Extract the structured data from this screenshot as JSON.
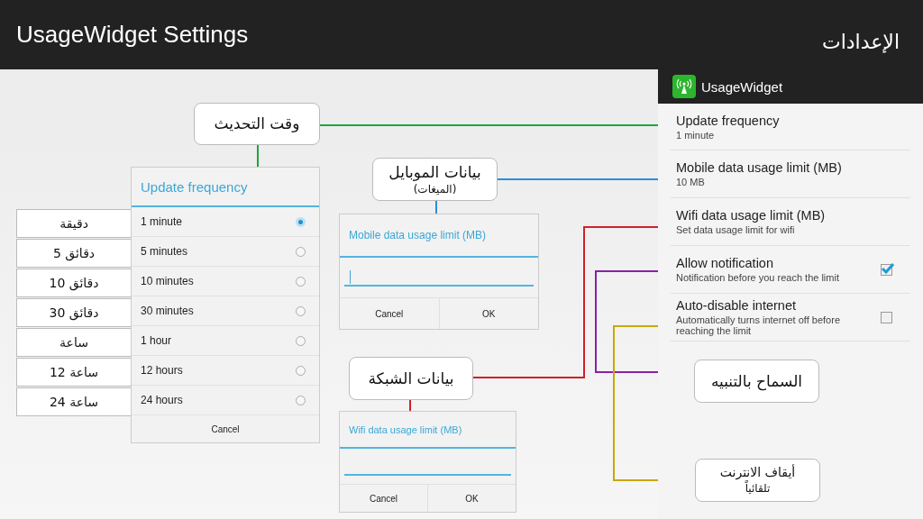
{
  "header": {
    "title": "UsageWidget Settings",
    "subtitle": "الإعدادات"
  },
  "app": {
    "title": "UsageWidget",
    "settings": [
      {
        "kind": "text",
        "title": "Update frequency",
        "summary": "1 minute"
      },
      {
        "kind": "text",
        "title": "Mobile data usage limit (MB)",
        "summary": "10 MB"
      },
      {
        "kind": "text",
        "title": "Wifi data usage limit (MB)",
        "summary": "Set data usage limit for wifi"
      },
      {
        "kind": "checkbox",
        "title": "Allow notification",
        "summary": "Notification before you reach the limit",
        "checked": true
      },
      {
        "kind": "checkbox",
        "title": "Auto-disable internet",
        "summary": "Automatically turns internet off before reaching the limit",
        "checked": false
      }
    ]
  },
  "frequency_dialog": {
    "title": "Update frequency",
    "options": [
      {
        "label": "1 minute",
        "selected": true
      },
      {
        "label": "5 minutes",
        "selected": false
      },
      {
        "label": "10 minutes",
        "selected": false
      },
      {
        "label": "30 minutes",
        "selected": false
      },
      {
        "label": "1 hour",
        "selected": false
      },
      {
        "label": "12 hours",
        "selected": false
      },
      {
        "label": "24 hours",
        "selected": false
      }
    ],
    "cancel": "Cancel"
  },
  "frequency_translations": [
    "دقيقة",
    "5 دقائق",
    "10 دقائق",
    "30 دقائق",
    "ساعة",
    "12 ساعة",
    "24 ساعة"
  ],
  "mobile_dialog": {
    "title": "Mobile data usage limit (MB)",
    "cursor": true,
    "cancel": "Cancel",
    "ok": "OK"
  },
  "wifi_dialog": {
    "title": "Wifi data usage limit (MB)",
    "cursor": false,
    "cancel": "Cancel",
    "ok": "OK"
  },
  "callouts": [
    {
      "lines": [
        "وقت التحديث"
      ],
      "color": "#22a33a"
    },
    {
      "lines": [
        "بيانات الموبايل",
        "(الميغات)"
      ],
      "color": "#2b8fd6"
    },
    {
      "lines": [
        "بيانات الشبكة"
      ],
      "color": "#d0202a"
    },
    {
      "lines": [
        "السماح بالتنبيه"
      ],
      "color": "#8a1fa8"
    },
    {
      "lines": [
        "أيقاف الانترنت",
        "تلقائياً"
      ],
      "color": "#c9a800"
    }
  ]
}
